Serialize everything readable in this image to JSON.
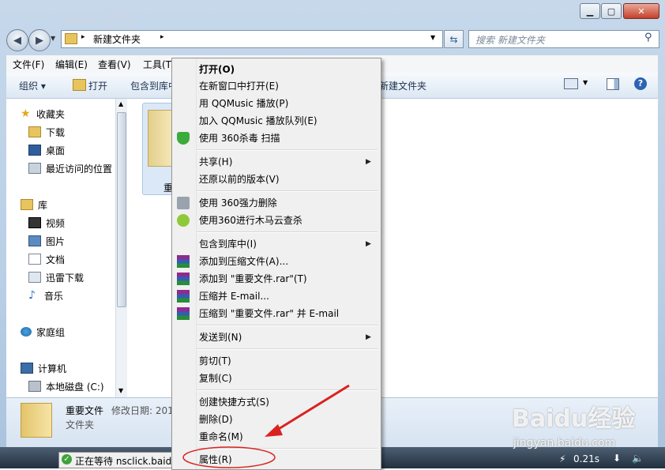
{
  "window": {
    "bg_logo": "Bai 经验"
  },
  "address": {
    "segments": [
      "新建文件夹"
    ],
    "search_placeholder": "搜索 新建文件夹"
  },
  "menubar": [
    "文件(F)",
    "编辑(E)",
    "查看(V)",
    "工具(T)"
  ],
  "toolbar": {
    "organize": "组织 ▾",
    "open": "打开",
    "include": "包含到库中",
    "newfolder": "新建文件夹"
  },
  "navpane": {
    "favorites": "收藏夹",
    "downloads": "下载",
    "desktop": "桌面",
    "recent": "最近访问的位置",
    "library": "库",
    "video": "视频",
    "pictures": "图片",
    "docs": "文档",
    "xunlei": "迅雷下载",
    "music": "音乐",
    "homegroup": "家庭组",
    "computer": "计算机",
    "localdisk": "本地磁盘 (C:)"
  },
  "folder_label": "重",
  "details": {
    "name": "重要文件",
    "date_label": "修改日期: 201",
    "type": "文件夹"
  },
  "context_menu": {
    "open": "打开(O)",
    "open_new": "在新窗口中打开(E)",
    "qq_play": "用 QQMusic 播放(P)",
    "qq_queue": "加入 QQMusic 播放队列(E)",
    "scan360": "使用 360杀毒 扫描",
    "share": "共享(H)",
    "restore": "还原以前的版本(V)",
    "del360": "使用 360强力删除",
    "trojan360": "使用360进行木马云查杀",
    "include": "包含到库中(I)",
    "add_archive": "添加到压缩文件(A)...",
    "add_rar": "添加到 \"重要文件.rar\"(T)",
    "zip_email": "压缩并 E-mail...",
    "rar_email": "压缩到 \"重要文件.rar\" 并 E-mail",
    "sendto": "发送到(N)",
    "cut": "剪切(T)",
    "copy": "复制(C)",
    "shortcut": "创建快捷方式(S)",
    "delete": "删除(D)",
    "rename": "重命名(M)",
    "properties": "属性(R)"
  },
  "taskbar": {
    "status": "正在等待 nsclick.baidu",
    "speed": "0.21s"
  },
  "watermark": {
    "brand": "Baidu经验",
    "url": "jingyan.baidu.com"
  },
  "colors": {
    "accent_red": "#d9231f",
    "menu_bg": "#f0f0f0"
  }
}
